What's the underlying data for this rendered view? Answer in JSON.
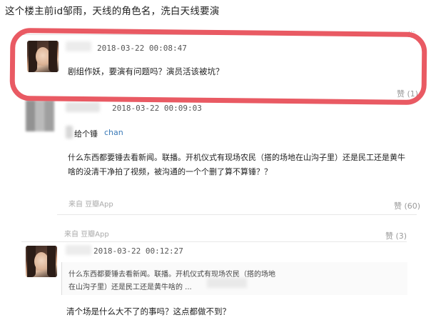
{
  "caption": "这个楼主前id邹雨，天线的角色名，洗白天线要演",
  "post1": {
    "time": "2018-03-22 00:08:47",
    "text": "剧组作妖，要演有问题吗？演员活该被坑？",
    "like": "赞 (1)"
  },
  "post2": {
    "time": "2018-03-22 00:09:03",
    "to_label": "给个锤",
    "to_user": "chan",
    "text_line1": "什么东西都要锤去看新闻。联播。开机仪式有现场农民（搭的场地在山沟子里）还是民工还是黄牛",
    "text_line2": "啥的没清干净拍了视频，被沟通的一个个删了算不算锤？？",
    "source": "来自 豆瓣App",
    "like": "赞 (60)"
  },
  "post3": {
    "source": "来自 豆瓣App",
    "like": "赞 (3)",
    "time": "2018-03-22 00:12:27",
    "quote_line1": "什么东西都要锤去看新闻。联播。开机仪式有现场农民（搭的场地",
    "quote_line2": "在山沟子里）还是民工还是黄牛啥的 ...",
    "text": "清个场是什么大不了的事吗？这点都做不到？"
  },
  "annotation_color": "#e95a63"
}
